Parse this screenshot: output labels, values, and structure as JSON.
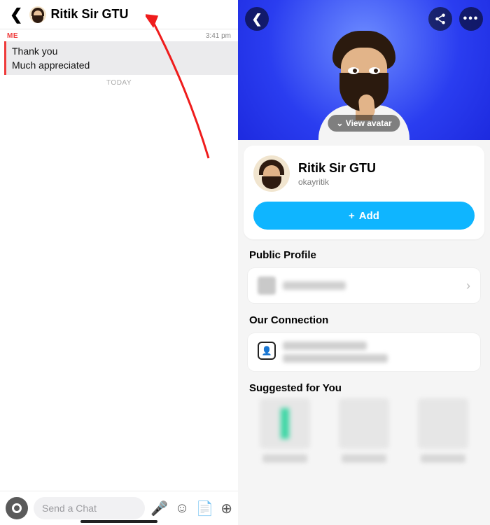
{
  "left": {
    "header_name": "Ritik Sir GTU",
    "me_label": "ME",
    "time": "3:41 pm",
    "messages": [
      "Thank you",
      "Much appreciated"
    ],
    "divider_label": "TODAY",
    "input_placeholder": "Send a Chat"
  },
  "right": {
    "view_avatar_label": "View avatar",
    "profile_name": "Ritik Sir GTU",
    "username": "okayritik",
    "add_label": "Add",
    "sections": {
      "public_profile": "Public Profile",
      "our_connection": "Our Connection",
      "suggested": "Suggested for You"
    }
  }
}
